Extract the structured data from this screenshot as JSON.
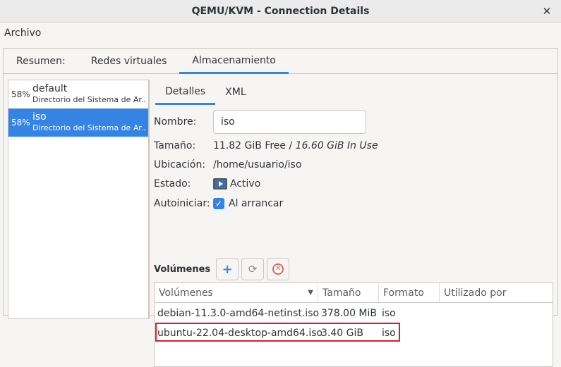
{
  "window": {
    "title": "QEMU/KVM - Connection Details",
    "close_glyph": "✕"
  },
  "menubar": {
    "items": [
      {
        "label": "Archivo"
      }
    ]
  },
  "tabs": [
    {
      "label": "Resumen"
    },
    {
      "label": "Redes virtuales"
    },
    {
      "label": "Almacenamiento",
      "active": true
    }
  ],
  "pools": [
    {
      "percent": "58%",
      "name": "default",
      "description": "Directorio del Sistema de Ar..."
    },
    {
      "percent": "58%",
      "name": "iso",
      "description": "Directorio del Sistema de Ar...",
      "selected": true
    }
  ],
  "subtabs": [
    {
      "label": "Detalles",
      "active": true
    },
    {
      "label": "XML"
    }
  ],
  "details": {
    "name_label": "Nombre:",
    "name_value": "iso",
    "size_label": "Tamaño:",
    "size_free": "11.82 GiB Free / ",
    "size_used": "16.60 GiB In Use",
    "location_label": "Ubicación:",
    "location_value": "/home/usuario/iso",
    "state_label": "Estado:",
    "state_value": "Activo",
    "autostart_label": "Autoiniciar:",
    "autostart_value": "Al arrancar",
    "autostart_checked": true
  },
  "volumes": {
    "title": "Volúmenes",
    "toolbar": {
      "add": "+",
      "refresh": "⟳",
      "delete": "✕"
    },
    "columns": [
      "Volúmenes",
      "Tamaño",
      "Formato",
      "Utilizado por"
    ],
    "rows": [
      {
        "name": "debian-11.3.0-amd64-netinst.iso",
        "size": "378.00 MiB",
        "format": "iso",
        "used_by": ""
      },
      {
        "name": "ubuntu-22.04-desktop-amd64.iso",
        "size": "3.40 GiB",
        "format": "iso",
        "used_by": ""
      }
    ]
  },
  "colors": {
    "accent": "#3584e4",
    "highlight": "#e01b24"
  }
}
